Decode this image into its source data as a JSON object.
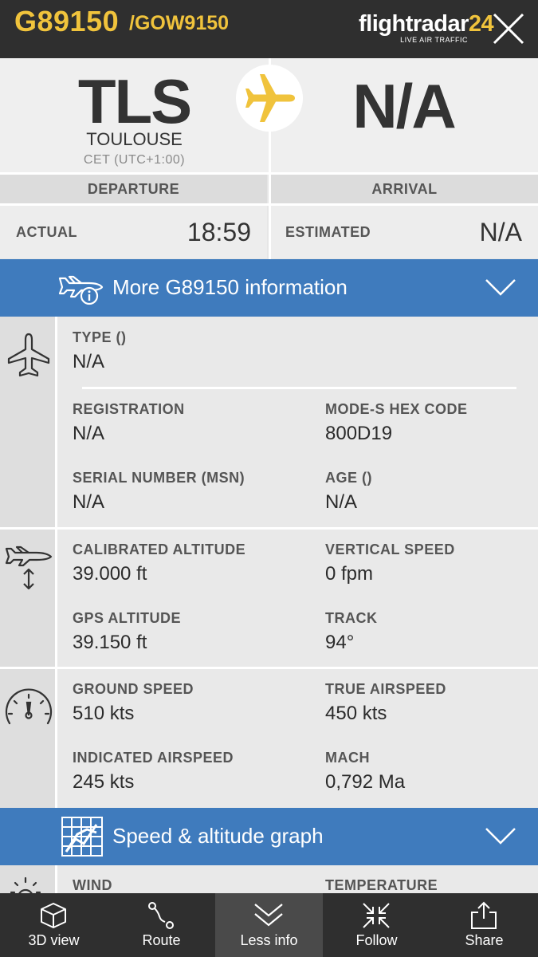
{
  "header": {
    "callsign": "G89150",
    "callsign2": "/GOW9150",
    "logo_main": "flightradar",
    "logo_num": "24",
    "logo_sub": "LIVE AIR TRAFFIC"
  },
  "route": {
    "departure": {
      "code": "TLS",
      "city": "TOULOUSE",
      "tz": "CET (UTC+1:00)",
      "label": "DEPARTURE",
      "time_label": "ACTUAL",
      "time": "18:59"
    },
    "arrival": {
      "code": "N/A",
      "label": "ARRIVAL",
      "time_label": "ESTIMATED",
      "time": "N/A"
    }
  },
  "more_info": {
    "label": "More G89150 information"
  },
  "aircraft": {
    "type_label": "TYPE ()",
    "type_value": "N/A",
    "registration_label": "REGISTRATION",
    "registration_value": "N/A",
    "hex_label": "MODE-S HEX CODE",
    "hex_value": "800D19",
    "msn_label": "SERIAL NUMBER (MSN)",
    "msn_value": "N/A",
    "age_label": "AGE ()",
    "age_value": "N/A"
  },
  "altitude": {
    "cal_alt_label": "CALIBRATED ALTITUDE",
    "cal_alt_value": "39.000 ft",
    "vs_label": "VERTICAL SPEED",
    "vs_value": "0 fpm",
    "gps_alt_label": "GPS ALTITUDE",
    "gps_alt_value": "39.150 ft",
    "track_label": "TRACK",
    "track_value": "94°"
  },
  "speed": {
    "gs_label": "GROUND SPEED",
    "gs_value": "510 kts",
    "tas_label": "TRUE AIRSPEED",
    "tas_value": "450 kts",
    "ias_label": "INDICATED AIRSPEED",
    "ias_value": "245 kts",
    "mach_label": "MACH",
    "mach_value": "0,792 Ma"
  },
  "graph": {
    "label": "Speed & altitude graph"
  },
  "weather": {
    "wind_label": "WIND",
    "temp_label": "TEMPERATURE"
  },
  "tabs": [
    {
      "label": "3D view"
    },
    {
      "label": "Route"
    },
    {
      "label": "Less info"
    },
    {
      "label": "Follow"
    },
    {
      "label": "Share"
    }
  ],
  "colors": {
    "accent_yellow": "#f0c33c",
    "blue_bar": "#3f7bbd",
    "dark": "#2f2f2f"
  }
}
